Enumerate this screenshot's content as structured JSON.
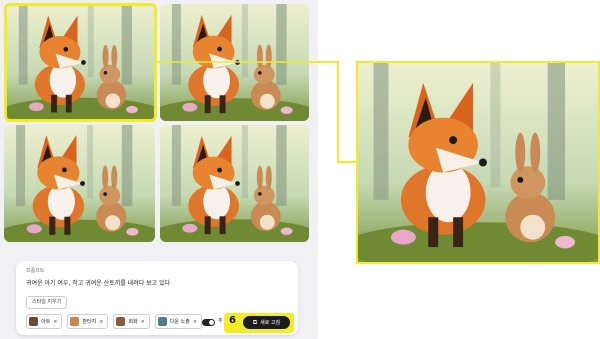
{
  "prompt": {
    "label": "프롬프트",
    "text": "귀여운 아기 여우, 작고 귀여운 산토끼를 내려다 보고 있다",
    "clear_style_label": "스타일 지우기"
  },
  "style_chips": [
    {
      "label": "아트",
      "icon": "art-thumbnail-icon"
    },
    {
      "label": "판타지",
      "icon": "fantasy-thumbnail-icon"
    },
    {
      "label": "회화",
      "icon": "painting-thumbnail-icon"
    },
    {
      "label": "다운 노출",
      "icon": "low-exposure-thumbnail-icon"
    }
  ],
  "toggle_label": "추",
  "callout": {
    "step": "6",
    "button_label": "새로 고침",
    "button_icon": "open-external-icon"
  },
  "colors": {
    "highlight": "#f1eb2a",
    "button_bg": "#1c1c1c",
    "panel_bg": "#f1f1f3"
  },
  "images": [
    {
      "name": "fox-rabbit-image-1",
      "selected": true
    },
    {
      "name": "fox-rabbit-image-2",
      "selected": false
    },
    {
      "name": "fox-rabbit-image-3",
      "selected": false
    },
    {
      "name": "fox-rabbit-image-4",
      "selected": false
    }
  ]
}
